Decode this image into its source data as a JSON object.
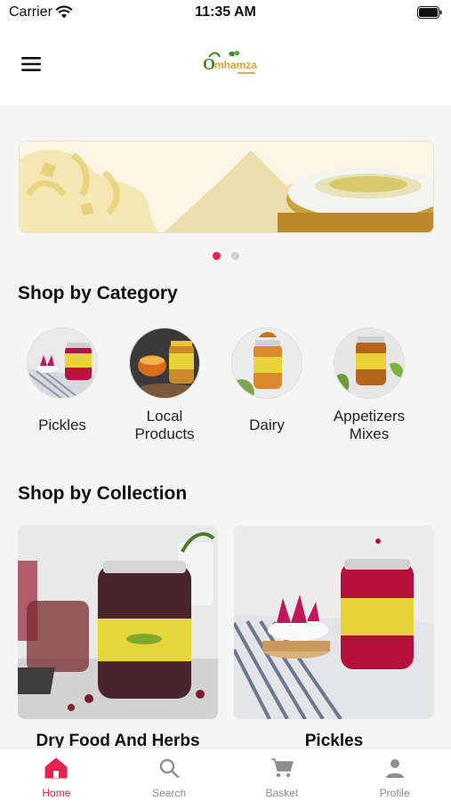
{
  "status": {
    "carrier": "Carrier",
    "time": "11:35 AM"
  },
  "header": {
    "menu_icon": "hamburger-menu-icon",
    "logo_text": "Omhamza"
  },
  "banner": {
    "dots_total": 2,
    "active_dot": 1
  },
  "sections": {
    "category_title": "Shop by Category",
    "collection_title": "Shop by Collection"
  },
  "categories": [
    {
      "label": "Pickles"
    },
    {
      "label": "Local Products"
    },
    {
      "label": "Dairy"
    },
    {
      "label": "Appetizers Mixes"
    }
  ],
  "collections": [
    {
      "label": "Dry Food And Herbs"
    },
    {
      "label": "Pickles"
    }
  ],
  "tabs": [
    {
      "label": "Home",
      "icon": "home-icon",
      "active": true
    },
    {
      "label": "Search",
      "icon": "search-icon",
      "active": false
    },
    {
      "label": "Basket",
      "icon": "cart-icon",
      "active": false
    },
    {
      "label": "Profile",
      "icon": "profile-icon",
      "active": false
    }
  ],
  "colors": {
    "accent": "#e5234b",
    "inactive_tab": "#8e8e8e",
    "brand_green": "#3a8a1e"
  }
}
